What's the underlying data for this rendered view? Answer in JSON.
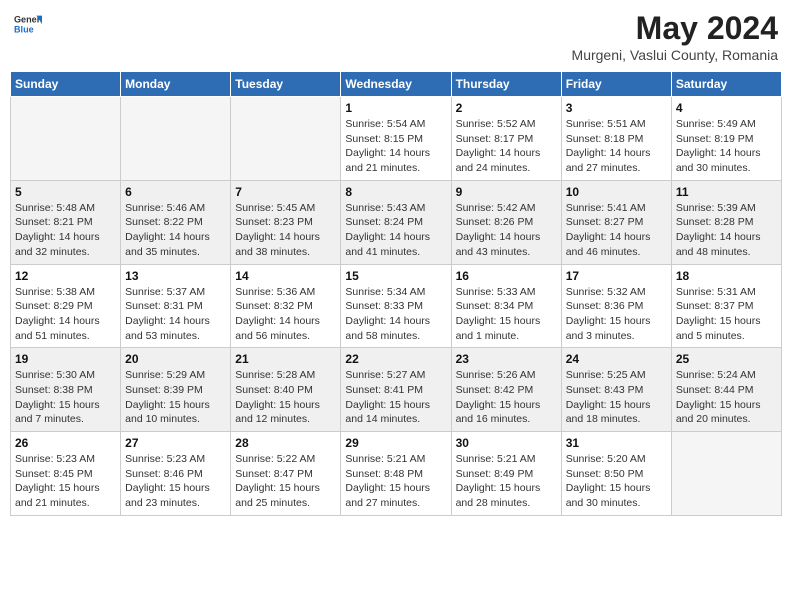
{
  "header": {
    "logo_general": "General",
    "logo_blue": "Blue",
    "month_title": "May 2024",
    "subtitle": "Murgeni, Vaslui County, Romania"
  },
  "weekdays": [
    "Sunday",
    "Monday",
    "Tuesday",
    "Wednesday",
    "Thursday",
    "Friday",
    "Saturday"
  ],
  "weeks": [
    [
      {
        "day": "",
        "info": ""
      },
      {
        "day": "",
        "info": ""
      },
      {
        "day": "",
        "info": ""
      },
      {
        "day": "1",
        "info": "Sunrise: 5:54 AM\nSunset: 8:15 PM\nDaylight: 14 hours\nand 21 minutes."
      },
      {
        "day": "2",
        "info": "Sunrise: 5:52 AM\nSunset: 8:17 PM\nDaylight: 14 hours\nand 24 minutes."
      },
      {
        "day": "3",
        "info": "Sunrise: 5:51 AM\nSunset: 8:18 PM\nDaylight: 14 hours\nand 27 minutes."
      },
      {
        "day": "4",
        "info": "Sunrise: 5:49 AM\nSunset: 8:19 PM\nDaylight: 14 hours\nand 30 minutes."
      }
    ],
    [
      {
        "day": "5",
        "info": "Sunrise: 5:48 AM\nSunset: 8:21 PM\nDaylight: 14 hours\nand 32 minutes."
      },
      {
        "day": "6",
        "info": "Sunrise: 5:46 AM\nSunset: 8:22 PM\nDaylight: 14 hours\nand 35 minutes."
      },
      {
        "day": "7",
        "info": "Sunrise: 5:45 AM\nSunset: 8:23 PM\nDaylight: 14 hours\nand 38 minutes."
      },
      {
        "day": "8",
        "info": "Sunrise: 5:43 AM\nSunset: 8:24 PM\nDaylight: 14 hours\nand 41 minutes."
      },
      {
        "day": "9",
        "info": "Sunrise: 5:42 AM\nSunset: 8:26 PM\nDaylight: 14 hours\nand 43 minutes."
      },
      {
        "day": "10",
        "info": "Sunrise: 5:41 AM\nSunset: 8:27 PM\nDaylight: 14 hours\nand 46 minutes."
      },
      {
        "day": "11",
        "info": "Sunrise: 5:39 AM\nSunset: 8:28 PM\nDaylight: 14 hours\nand 48 minutes."
      }
    ],
    [
      {
        "day": "12",
        "info": "Sunrise: 5:38 AM\nSunset: 8:29 PM\nDaylight: 14 hours\nand 51 minutes."
      },
      {
        "day": "13",
        "info": "Sunrise: 5:37 AM\nSunset: 8:31 PM\nDaylight: 14 hours\nand 53 minutes."
      },
      {
        "day": "14",
        "info": "Sunrise: 5:36 AM\nSunset: 8:32 PM\nDaylight: 14 hours\nand 56 minutes."
      },
      {
        "day": "15",
        "info": "Sunrise: 5:34 AM\nSunset: 8:33 PM\nDaylight: 14 hours\nand 58 minutes."
      },
      {
        "day": "16",
        "info": "Sunrise: 5:33 AM\nSunset: 8:34 PM\nDaylight: 15 hours\nand 1 minute."
      },
      {
        "day": "17",
        "info": "Sunrise: 5:32 AM\nSunset: 8:36 PM\nDaylight: 15 hours\nand 3 minutes."
      },
      {
        "day": "18",
        "info": "Sunrise: 5:31 AM\nSunset: 8:37 PM\nDaylight: 15 hours\nand 5 minutes."
      }
    ],
    [
      {
        "day": "19",
        "info": "Sunrise: 5:30 AM\nSunset: 8:38 PM\nDaylight: 15 hours\nand 7 minutes."
      },
      {
        "day": "20",
        "info": "Sunrise: 5:29 AM\nSunset: 8:39 PM\nDaylight: 15 hours\nand 10 minutes."
      },
      {
        "day": "21",
        "info": "Sunrise: 5:28 AM\nSunset: 8:40 PM\nDaylight: 15 hours\nand 12 minutes."
      },
      {
        "day": "22",
        "info": "Sunrise: 5:27 AM\nSunset: 8:41 PM\nDaylight: 15 hours\nand 14 minutes."
      },
      {
        "day": "23",
        "info": "Sunrise: 5:26 AM\nSunset: 8:42 PM\nDaylight: 15 hours\nand 16 minutes."
      },
      {
        "day": "24",
        "info": "Sunrise: 5:25 AM\nSunset: 8:43 PM\nDaylight: 15 hours\nand 18 minutes."
      },
      {
        "day": "25",
        "info": "Sunrise: 5:24 AM\nSunset: 8:44 PM\nDaylight: 15 hours\nand 20 minutes."
      }
    ],
    [
      {
        "day": "26",
        "info": "Sunrise: 5:23 AM\nSunset: 8:45 PM\nDaylight: 15 hours\nand 21 minutes."
      },
      {
        "day": "27",
        "info": "Sunrise: 5:23 AM\nSunset: 8:46 PM\nDaylight: 15 hours\nand 23 minutes."
      },
      {
        "day": "28",
        "info": "Sunrise: 5:22 AM\nSunset: 8:47 PM\nDaylight: 15 hours\nand 25 minutes."
      },
      {
        "day": "29",
        "info": "Sunrise: 5:21 AM\nSunset: 8:48 PM\nDaylight: 15 hours\nand 27 minutes."
      },
      {
        "day": "30",
        "info": "Sunrise: 5:21 AM\nSunset: 8:49 PM\nDaylight: 15 hours\nand 28 minutes."
      },
      {
        "day": "31",
        "info": "Sunrise: 5:20 AM\nSunset: 8:50 PM\nDaylight: 15 hours\nand 30 minutes."
      },
      {
        "day": "",
        "info": ""
      }
    ]
  ]
}
